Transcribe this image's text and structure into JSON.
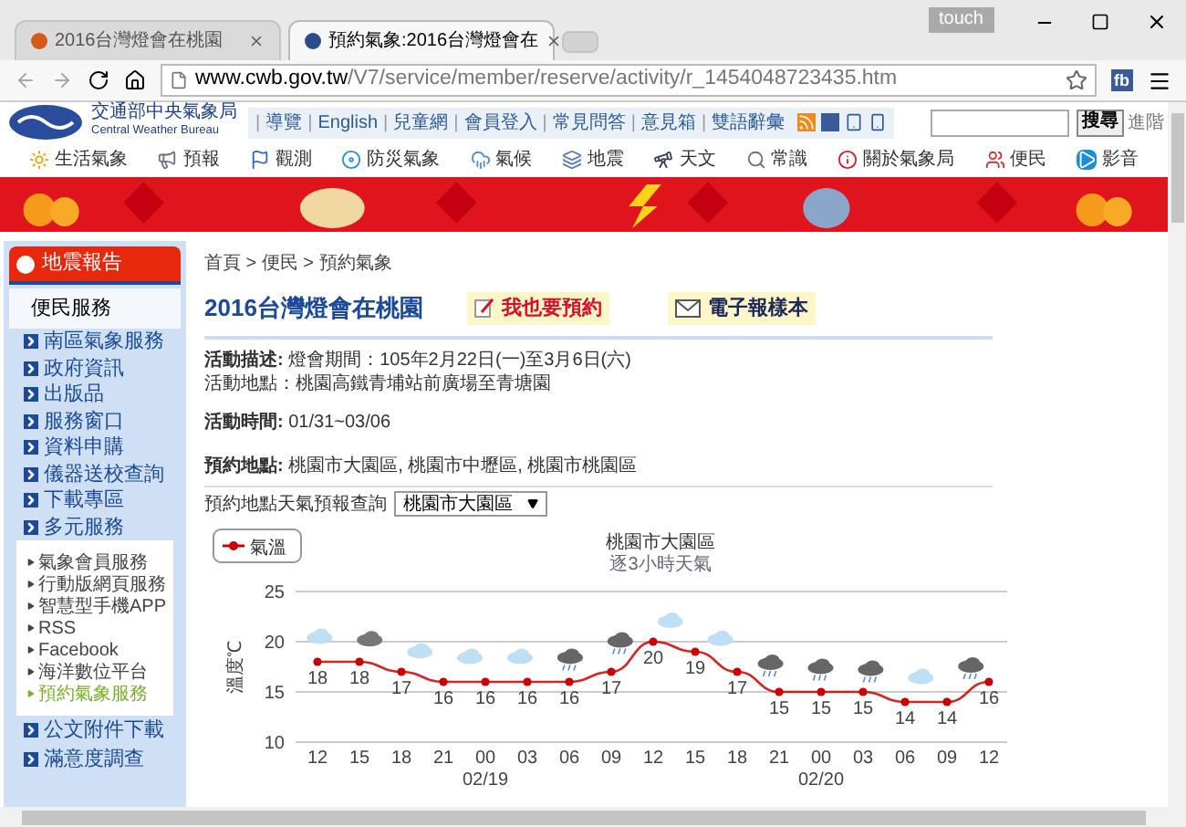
{
  "browser": {
    "tabs": [
      {
        "title": "2016台灣燈會在桃園",
        "selected": false
      },
      {
        "title": "預約氣象:2016台灣燈會在",
        "selected": true
      }
    ],
    "badge": "touch",
    "address": {
      "domain": "www.cwb.gov.tw",
      "path": "/V7/service/member/reserve/activity/r_1454048723435.htm"
    },
    "extension": "fb"
  },
  "site": {
    "logo_zh": "交通部中央氣象局",
    "logo_en": "Central Weather Bureau",
    "link_separator": "|",
    "links": [
      "導覽",
      "English",
      "兒童網",
      "會員登入",
      "常見問答",
      "意見箱",
      "雙語辭彙"
    ],
    "search": {
      "button": "搜尋",
      "advanced": "進階"
    },
    "nav": [
      "生活氣象",
      "預報",
      "觀測",
      "防災氣象",
      "氣候",
      "地震",
      "天文",
      "常識",
      "關於氣象局",
      "便民",
      "影音"
    ]
  },
  "sidebar": {
    "alert": "地震報告",
    "heading": "便民服務",
    "items": [
      {
        "label": "南區氣象服務"
      },
      {
        "label": "政府資訊"
      },
      {
        "label": "出版品"
      },
      {
        "label": "服務窗口"
      },
      {
        "label": "資料申購"
      },
      {
        "label": "儀器送校查詢"
      },
      {
        "label": "下載專區"
      },
      {
        "label": "多元服務"
      }
    ],
    "subitems": [
      {
        "label": "氣象會員服務",
        "selected": false
      },
      {
        "label": "行動版網頁服務",
        "selected": false
      },
      {
        "label": "智慧型手機APP",
        "selected": false
      },
      {
        "label": "RSS",
        "selected": false
      },
      {
        "label": "Facebook",
        "selected": false
      },
      {
        "label": "海洋數位平台",
        "selected": false
      },
      {
        "label": "預約氣象服務",
        "selected": true
      }
    ],
    "more_items": [
      {
        "label": "公文附件下載"
      },
      {
        "label": "滿意度調查"
      }
    ]
  },
  "main": {
    "breadcrumb": "首頁 > 便民 > 預約氣象",
    "title": "2016台灣燈會在桃園",
    "reserve_button": "我也要預約",
    "newsletter_button": "電子報樣本",
    "details": [
      "**活動描述:** 燈會期間：105年2月22日(一)至3月6日(六)",
      "活動地點：桃園高鐵青埔站前廣場至青塘園"
    ],
    "time": "**活動時間:** 01/31~03/06",
    "places": "**預約地點:** 桃園市大園區, 桃園市中壢區, 桃園市桃園區",
    "query_label": "預約地點天氣預報查詢",
    "query_value": "桃園市大園區",
    "chart": {
      "subtitle": "逐3小時天氣",
      "dates": [
        {
          "label": "02/19"
        },
        {
          "label": "02/20"
        }
      ],
      "sky": [
        {
          "kind": "cloudy"
        },
        {
          "kind": "overcast"
        },
        {
          "kind": "cloudy"
        },
        {
          "kind": "cloudy"
        },
        {
          "kind": "cloudy"
        },
        {
          "kind": "rain"
        },
        {
          "kind": "rain"
        },
        {
          "kind": "cloudy"
        },
        {
          "kind": "cloudy"
        },
        {
          "kind": "rain"
        },
        {
          "kind": "rain"
        },
        {
          "kind": "rain"
        },
        {
          "kind": "cloudy"
        },
        {
          "kind": "rain"
        }
      ],
      "chart_data": {
        "type": "line",
        "title": "桃園市大園區",
        "ylabel": "溫度℃",
        "categories": [
          "12",
          "15",
          "18",
          "21",
          "00",
          "03",
          "06",
          "09",
          "12",
          "15",
          "18",
          "21",
          "00",
          "03",
          "06",
          "09",
          "12"
        ],
        "series": [
          {
            "name": "氣溫",
            "color": "#cc0000",
            "marker": "circle",
            "values": [
              18,
              18,
              17,
              16,
              16,
              16,
              16,
              17,
              20,
              19,
              17,
              15,
              15,
              15,
              14,
              14,
              16
            ]
          }
        ],
        "ylim": [
          10,
          25
        ],
        "yticks": [
          10,
          15,
          20,
          25
        ],
        "data_labels": true
      }
    }
  }
}
